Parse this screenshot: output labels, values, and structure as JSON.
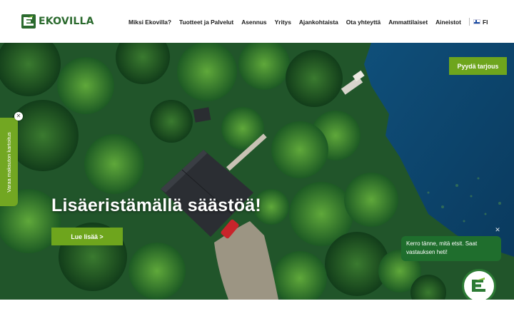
{
  "brand": {
    "name": "EKOVILLA",
    "logo_icon": "ekovilla-logo-icon",
    "green": "#2b6a2e",
    "accent": "#6ea51d"
  },
  "nav": {
    "items": [
      {
        "label": "Miksi Ekovilla?"
      },
      {
        "label": "Tuotteet ja Palvelut"
      },
      {
        "label": "Asennus"
      },
      {
        "label": "Yritys"
      },
      {
        "label": "Ajankohtaista"
      },
      {
        "label": "Ota yhteyttä"
      },
      {
        "label": "Ammattilaiset"
      },
      {
        "label": "Aineistot"
      }
    ],
    "language": "FI",
    "language_icon": "finland-flag-icon"
  },
  "hero": {
    "title": "Lisäeristämällä säästöä!",
    "cta_label": "Lue lisää >",
    "offer_label": "Pyydä tarjous",
    "image": "aerial-forest-lake-cabin"
  },
  "side_tab": {
    "label": "Varaa maksuton kartoitus",
    "close_icon": "close-icon"
  },
  "chat": {
    "message": "Kerro tänne, mitä etsit. Saat vastauksen heti!",
    "close_icon": "close-icon",
    "launcher_icon": "chat-launcher-icon"
  }
}
